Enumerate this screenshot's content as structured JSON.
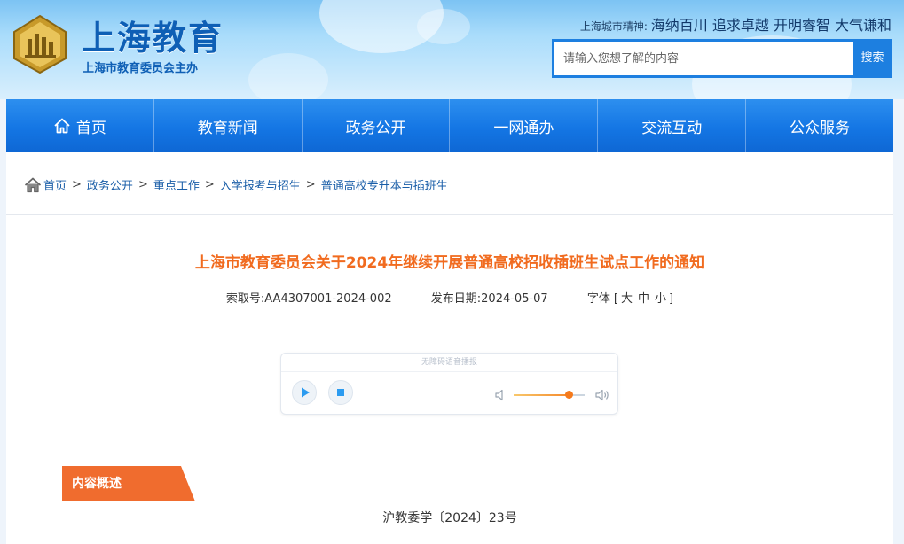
{
  "header": {
    "site_title": "上海教育",
    "site_subtitle": "上海市教育委员会主办",
    "city_spirit_label": "上海城市精神:",
    "city_spirit_text": "海纳百川 追求卓越 开明睿智 大气谦和",
    "search_placeholder": "请输入您想了解的内容",
    "search_button": "搜索"
  },
  "nav": {
    "items": [
      {
        "label": "首页",
        "icon": "home-icon"
      },
      {
        "label": "教育新闻"
      },
      {
        "label": "政务公开"
      },
      {
        "label": "一网通办"
      },
      {
        "label": "交流互动"
      },
      {
        "label": "公众服务"
      }
    ]
  },
  "breadcrumb": {
    "icon": "home-icon",
    "items": [
      "首页",
      "政务公开",
      "重点工作",
      "入学报考与招生",
      "普通高校专升本与插班生"
    ],
    "separator": ">"
  },
  "article": {
    "title": "上海市教育委员会关于2024年继续开展普通高校招收插班生试点工作的通知",
    "index_label": "索取号:",
    "index_value": "AA4307001-2024-002",
    "date_label": "发布日期:",
    "date_value": "2024-05-07",
    "font_label": "字体",
    "font_open": "[",
    "font_large": "大",
    "font_medium": "中",
    "font_small": "小",
    "font_close": "]"
  },
  "player": {
    "header_text": "无障碍语音播报",
    "volume_level": 0.78,
    "accent_color": "#f57a1c"
  },
  "section": {
    "tag_label": "内容概述",
    "tag_color": "#f06c2e"
  },
  "doc": {
    "number": "沪教委学〔2024〕23号"
  }
}
